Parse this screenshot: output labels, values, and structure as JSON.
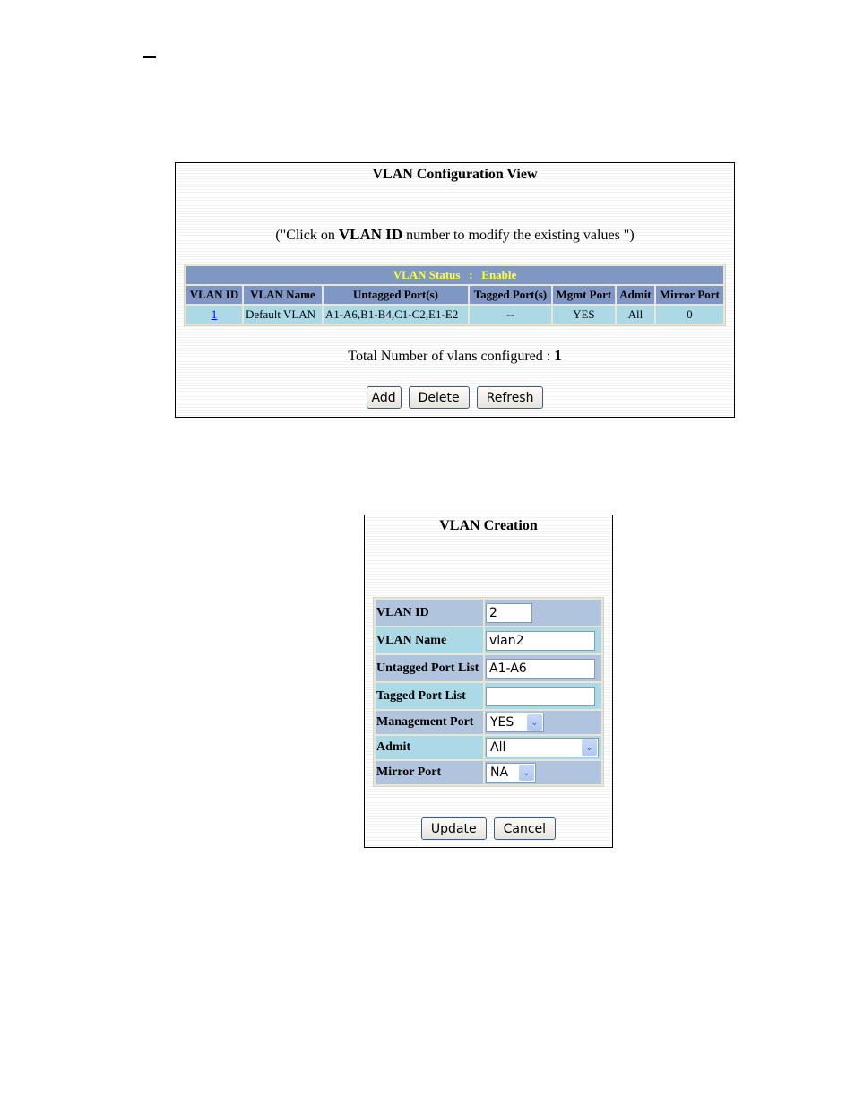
{
  "config_view": {
    "title": "VLAN Configuration View",
    "hint_prefix": "(\"Click on ",
    "hint_bold": "VLAN ID",
    "hint_suffix": " number to modify the existing values \")",
    "status_label": "VLAN Status   :   Enable",
    "columns": [
      "VLAN ID",
      "VLAN Name",
      "Untagged Port(s)",
      "Tagged Port(s)",
      "Mgmt Port",
      "Admit",
      "Mirror Port"
    ],
    "rows": [
      {
        "vlan_id": "1",
        "vlan_name": "Default VLAN",
        "untagged_ports": "A1-A6,B1-B4,C1-C2,E1-E2",
        "tagged_ports": "--",
        "mgmt_port": "YES",
        "admit": "All",
        "mirror_port": "0"
      }
    ],
    "total_label": "Total Number of vlans configured : ",
    "total_value": "1",
    "buttons": {
      "add": "Add",
      "delete": "Delete",
      "refresh": "Refresh"
    }
  },
  "creation": {
    "title": "VLAN Creation",
    "fields": {
      "vlan_id": {
        "label": "VLAN ID",
        "value": "2"
      },
      "vlan_name": {
        "label": "VLAN Name",
        "value": "vlan2"
      },
      "untagged": {
        "label": "Untagged Port List",
        "value": "A1-A6"
      },
      "tagged": {
        "label": "Tagged Port List",
        "value": ""
      },
      "mgmt": {
        "label": "Management Port",
        "selected": "YES"
      },
      "admit": {
        "label": "Admit",
        "selected": "All"
      },
      "mirror": {
        "label": "Mirror Port",
        "selected": "NA"
      }
    },
    "buttons": {
      "update": "Update",
      "cancel": "Cancel"
    }
  },
  "colors": {
    "header_bg": "#7f97c4",
    "status_text": "#ffff33",
    "row_bg": "#abd9e6",
    "form_alt_bg": "#b0c4de",
    "link": "#0000ee"
  }
}
